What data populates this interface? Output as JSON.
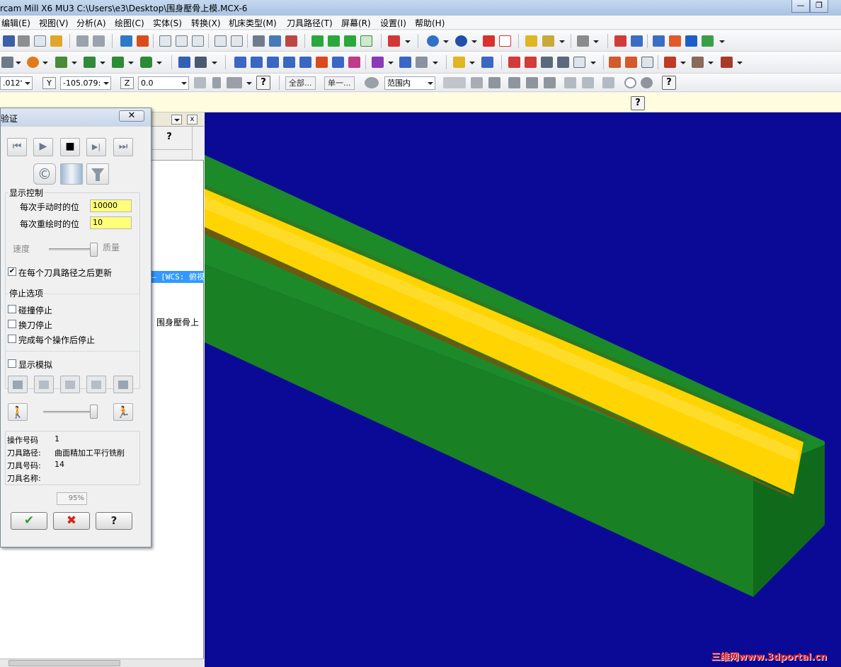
{
  "window": {
    "title": "rcam Mill X6 MU3  C:\\Users\\e3\\Desktop\\围身壓骨上模.MCX-6",
    "minimize_glyph": "—",
    "restore_glyph": "❐"
  },
  "menu": [
    {
      "label": "编辑(E)"
    },
    {
      "label": "视图(V)"
    },
    {
      "label": "分析(A)"
    },
    {
      "label": "绘图(C)"
    },
    {
      "label": "实体(S)"
    },
    {
      "label": "转换(X)"
    },
    {
      "label": "机床类型(M)"
    },
    {
      "label": "刀具路径(T)"
    },
    {
      "label": "屏幕(R)"
    },
    {
      "label": "设置(I)"
    },
    {
      "label": "帮助(H)"
    }
  ],
  "coordbar": {
    "x_value": ".012'",
    "y_label": "Y",
    "y_value": "-105.079:",
    "z_label": "Z",
    "z_value": "0.0",
    "help_glyph": "?",
    "all_button": "全部...",
    "single_button": "单一...",
    "range_value": "范围内"
  },
  "prompt": {
    "help_glyph": "?"
  },
  "left_panel": {
    "help_glyph": "?",
    "close_glyph": "x",
    "tree_item_1": "— [WCS: 俯视",
    "tree_item_2": "围身壓骨上"
  },
  "dialog": {
    "title": "验证",
    "close_glyph": "✕",
    "playback": {
      "rewind": "⏮",
      "play": "▶",
      "stop": "■",
      "step": "▶|",
      "fast_forward": "⏭"
    },
    "mode_glyph": "©",
    "display_control": {
      "title": "显示控制",
      "manual_label": "每次手动时的位",
      "manual_value": "10000",
      "redraw_label": "每次重绘时的位",
      "redraw_value": "10",
      "speed_label": "速度",
      "quality_label": "质量",
      "speed_quality_level": 1.0,
      "update_after_each_label": "在每个刀具路径之后更新",
      "update_after_each_checked": true
    },
    "stop_options": {
      "title": "停止选项",
      "collision_label": "碰撞停止",
      "toolchange_label": "换刀停止",
      "after_op_label": "完成每个操作后停止"
    },
    "show_simulation_label": "显示模拟",
    "playback_speed_level": 0.95,
    "info": {
      "op_number_label": "操作号码",
      "op_number_value": "1",
      "toolpath_label": "刀具路径:",
      "toolpath_value": "曲面精加工平行铣削",
      "tool_number_label": "刀具号码:",
      "tool_number_value": "14",
      "tool_name_label": "刀具名称:",
      "tool_name_value": ""
    },
    "progress": "95%",
    "ok_glyph": "✔",
    "cancel_glyph": "✖",
    "help_glyph": "?"
  },
  "viewport": {
    "background_color": "#0a0a96",
    "part_color": "#1d8a2a",
    "finish_color": "#ffd400"
  },
  "watermark": "三维网www.3dportal.cn"
}
